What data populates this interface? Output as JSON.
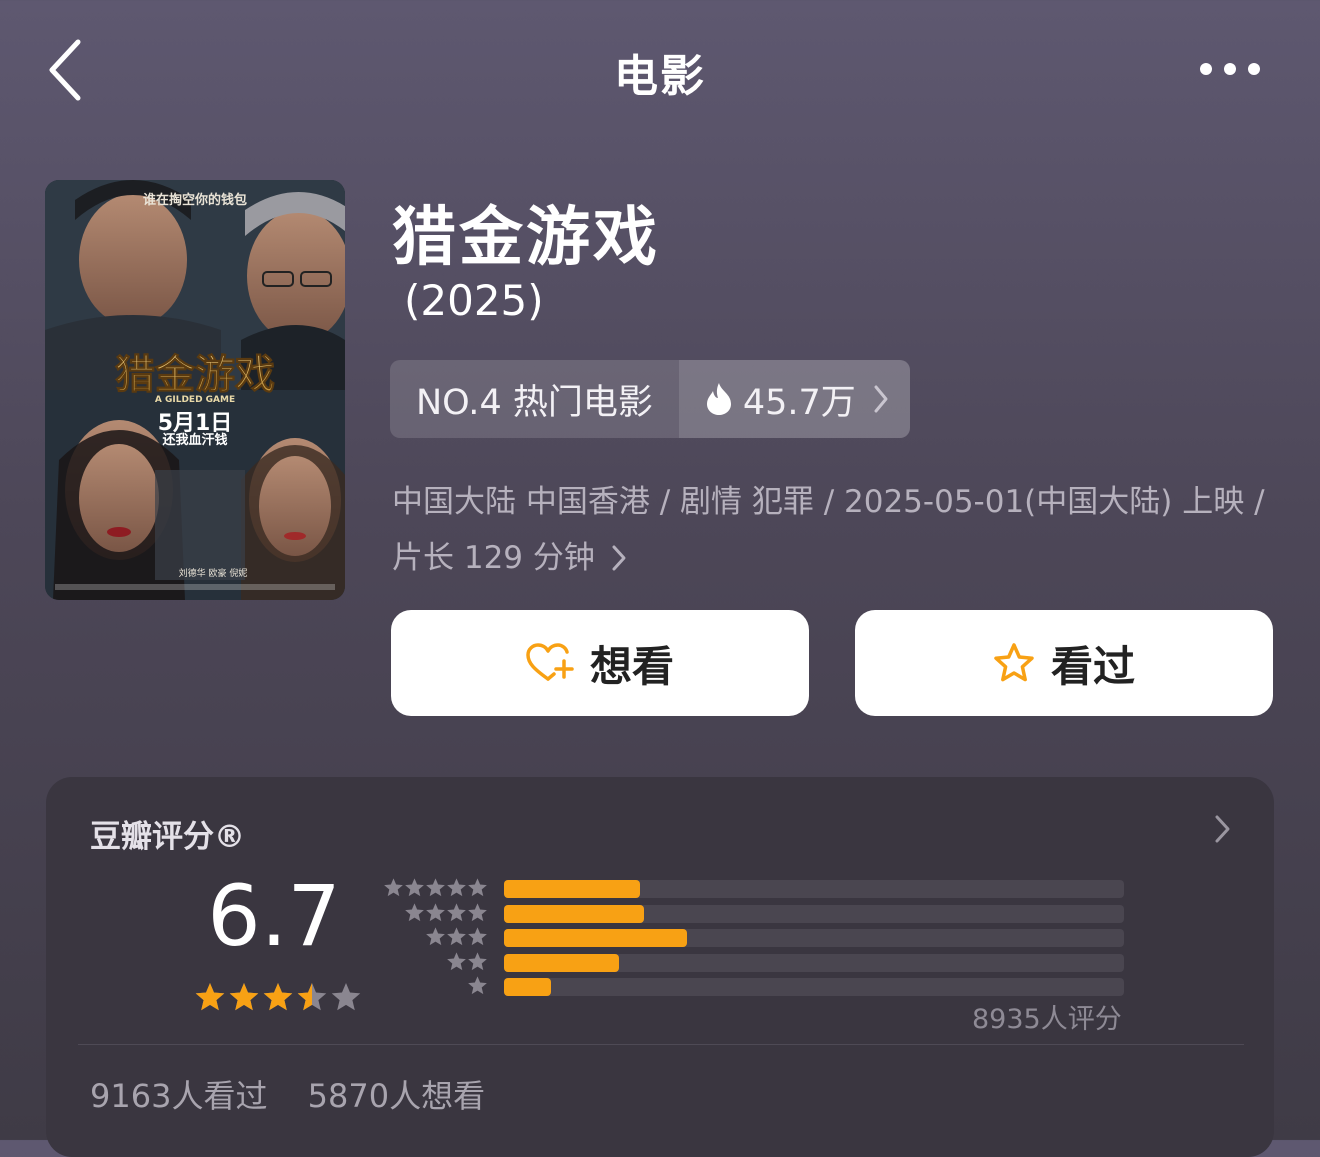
{
  "nav": {
    "title": "电影",
    "back_icon": "chevron-left-icon",
    "more_icon": "ellipsis-icon"
  },
  "movie": {
    "title": "猎金游戏",
    "year": "(2025)",
    "poster": {
      "tagline": "谁在掏空你的钱包",
      "title": "猎金游戏",
      "english_title": "A GILDED GAME",
      "date": "5月1日",
      "slogan": "还我血汗钱",
      "credits": "刘德华 欧豪 倪妮"
    },
    "rank": {
      "label": "NO.4 热门电影",
      "heat": "45.7万",
      "heat_icon": "flame-icon"
    },
    "meta": "中国大陆 中国香港 / 剧情 犯罪 / 2025-05-01(中国大陆) 上映 / 片长 129 分钟"
  },
  "actions": {
    "want": {
      "label": "想看",
      "icon": "heart-plus-icon"
    },
    "seen": {
      "label": "看过",
      "icon": "star-outline-icon"
    }
  },
  "rating": {
    "title": "豆瓣评分®",
    "score": "6.7",
    "stars_filled": 3.5,
    "stars_total": 5,
    "distribution": [
      {
        "stars": 5,
        "fraction": 0.22
      },
      {
        "stars": 4,
        "fraction": 0.225
      },
      {
        "stars": 3,
        "fraction": 0.295
      },
      {
        "stars": 2,
        "fraction": 0.185
      },
      {
        "stars": 1,
        "fraction": 0.075
      }
    ],
    "count": "8935人评分",
    "seen": "9163人看过",
    "want": "5870人想看"
  },
  "colors": {
    "accent": "#f8a114",
    "star_empty": "#8a8690",
    "card": "#3a3640"
  }
}
